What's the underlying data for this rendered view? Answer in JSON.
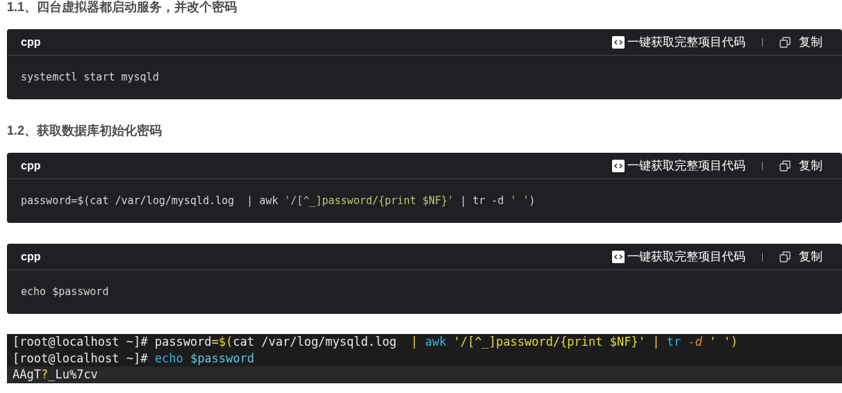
{
  "blocks": [
    {
      "kind": "heading",
      "text": "1.1、四台虚拟器都启动服务，并改个密码"
    },
    {
      "kind": "code",
      "language": "cpp",
      "action": "一键获取完整项目代码",
      "copy": "复制",
      "tokens": [
        {
          "kind": "plain",
          "text": "systemctl start mysqld"
        }
      ]
    },
    {
      "kind": "heading",
      "text": "1.2、获取数据库初始化密码"
    },
    {
      "kind": "code",
      "language": "cpp",
      "action": "一键获取完整项目代码",
      "copy": "复制",
      "tokens": [
        {
          "kind": "plain",
          "text": "password=$(cat /var/log/mysqld.log  | awk "
        },
        {
          "kind": "string",
          "text": "'/[^_]password/{print $NF}'"
        },
        {
          "kind": "plain",
          "text": " | tr -d "
        },
        {
          "kind": "string",
          "text": "' '"
        },
        {
          "kind": "plain",
          "text": ")"
        }
      ]
    },
    {
      "kind": "code",
      "language": "cpp",
      "action": "一键获取完整项目代码",
      "copy": "复制",
      "tokens": [
        {
          "kind": "plain",
          "text": "echo $password"
        }
      ]
    },
    {
      "kind": "terminal",
      "lines": [
        [
          {
            "kind": "plain",
            "text": "[root@localhost ~]# password"
          },
          {
            "kind": "punct",
            "text": "=$("
          },
          {
            "kind": "plain",
            "text": "cat /var/log/mysqld.log  "
          },
          {
            "kind": "punct",
            "text": "| "
          },
          {
            "kind": "command",
            "text": "awk"
          },
          {
            "kind": "punct",
            "text": " '/[^_]password/{print $NF}' | "
          },
          {
            "kind": "command",
            "text": "tr"
          },
          {
            "kind": "flag",
            "text": " -d"
          },
          {
            "kind": "punct",
            "text": " ' ')"
          }
        ],
        [
          {
            "kind": "plain",
            "text": "[root@localhost ~]# "
          },
          {
            "kind": "command",
            "text": "echo"
          },
          {
            "kind": "variable",
            "text": " $password"
          }
        ],
        [
          {
            "kind": "plain",
            "text": "AAgT"
          },
          {
            "kind": "punct",
            "text": "?"
          },
          {
            "kind": "plain",
            "text": "_Lu%7cv"
          }
        ]
      ]
    }
  ]
}
